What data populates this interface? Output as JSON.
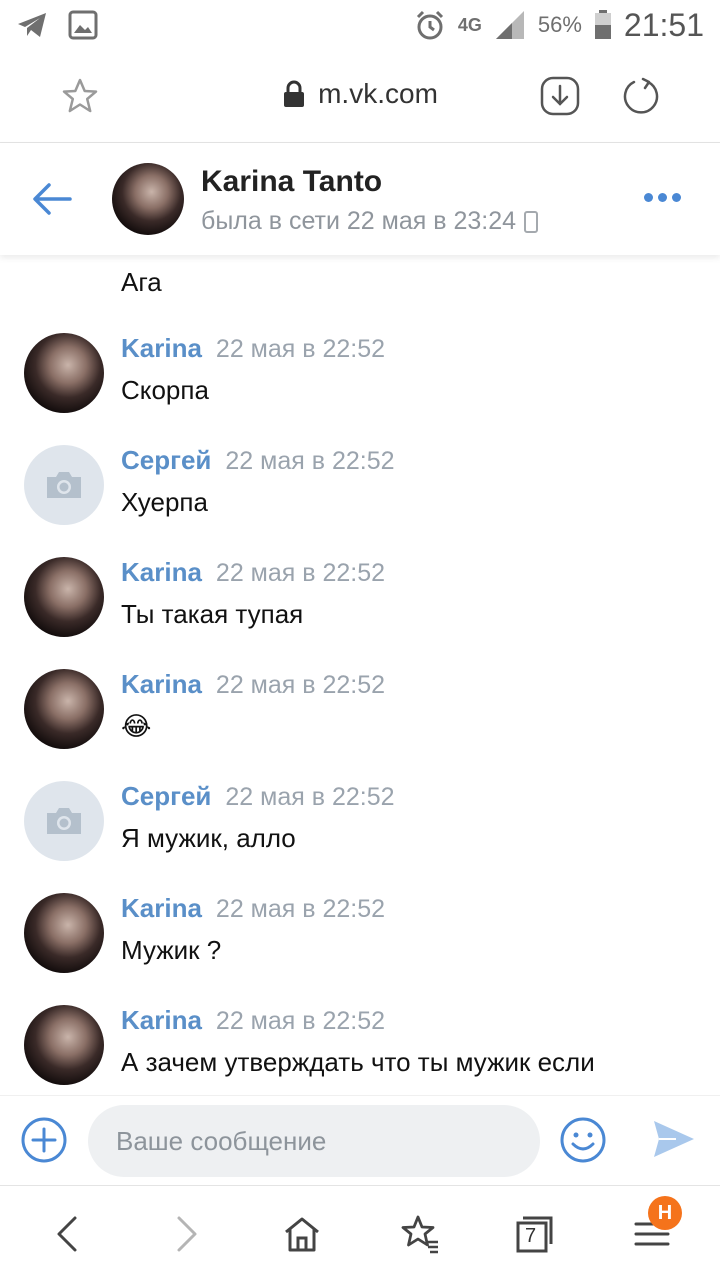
{
  "status_bar": {
    "network": "4G",
    "battery": "56%",
    "time": "21:51"
  },
  "browser": {
    "url": "m.vk.com"
  },
  "chat_header": {
    "name": "Karina Tanto",
    "status": "была в сети 22 мая в 23:24"
  },
  "messages": {
    "previous_text": "Ага",
    "items": [
      {
        "author": "Karina",
        "time": "22 мая в 22:52",
        "text": "Скорпа",
        "avatar": "photo"
      },
      {
        "author": "Сергей",
        "time": "22 мая в 22:52",
        "text": "Хуерпа",
        "avatar": "camera-placeholder"
      },
      {
        "author": "Karina",
        "time": "22 мая в 22:52",
        "text": "Ты такая тупая",
        "avatar": "photo"
      },
      {
        "author": "Karina",
        "time": "22 мая в 22:52",
        "text": "😂",
        "avatar": "photo"
      },
      {
        "author": "Сергей",
        "time": "22 мая в 22:52",
        "text": "Я мужик, алло",
        "avatar": "camera-placeholder"
      },
      {
        "author": "Karina",
        "time": "22 мая в 22:52",
        "text": "Мужик ?",
        "avatar": "photo"
      },
      {
        "author": "Karina",
        "time": "22 мая в 22:52",
        "text": "А зачем утверждать что ты мужик если",
        "avatar": "photo"
      }
    ]
  },
  "composer": {
    "placeholder": "Ваше сообщение"
  },
  "bottom_nav": {
    "tabs_count": "7",
    "menu_badge": "Н"
  },
  "colors": {
    "accent": "#4a88d4",
    "author_name": "#5a8fc8",
    "timestamp": "#9aa3ad",
    "badge": "#f5731b"
  }
}
